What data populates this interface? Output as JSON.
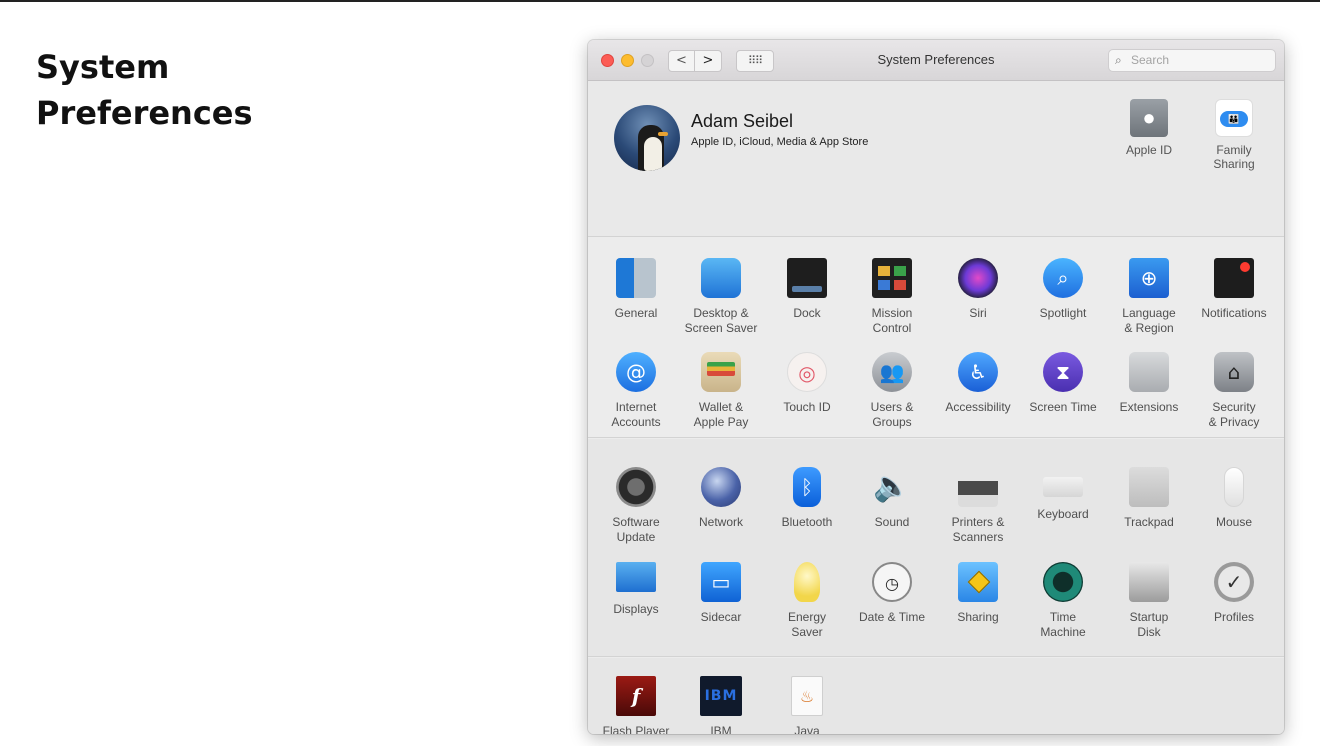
{
  "slide": {
    "title_line1": "System",
    "title_line2": "Preferences"
  },
  "window": {
    "title": "System Preferences",
    "nav": {
      "back": "<",
      "forward": ">",
      "grid": "⠿⠿"
    },
    "search": {
      "placeholder": "Search"
    }
  },
  "account": {
    "name": "Adam Seibel",
    "subtitle": "Apple ID, iCloud, Media & App Store",
    "items": [
      {
        "label": "Apple ID",
        "icon": "apple-icon"
      },
      {
        "label": "Family\nSharing",
        "icon": "family-sharing-icon"
      }
    ]
  },
  "panes_row1": [
    {
      "label": "General",
      "icon": "general-icon"
    },
    {
      "label": "Desktop &\nScreen Saver",
      "icon": "desktop-icon"
    },
    {
      "label": "Dock",
      "icon": "dock-icon"
    },
    {
      "label": "Mission\nControl",
      "icon": "mission-control-icon"
    },
    {
      "label": "Siri",
      "icon": "siri-icon"
    },
    {
      "label": "Spotlight",
      "icon": "spotlight-icon"
    },
    {
      "label": "Language\n& Region",
      "icon": "language-icon"
    },
    {
      "label": "Notifications",
      "icon": "notifications-icon"
    }
  ],
  "panes_row2": [
    {
      "label": "Internet\nAccounts",
      "icon": "internet-accounts-icon"
    },
    {
      "label": "Wallet &\nApple Pay",
      "icon": "wallet-icon"
    },
    {
      "label": "Touch ID",
      "icon": "fingerprint-icon"
    },
    {
      "label": "Users &\nGroups",
      "icon": "users-icon"
    },
    {
      "label": "Accessibility",
      "icon": "accessibility-icon"
    },
    {
      "label": "Screen Time",
      "icon": "hourglass-icon"
    },
    {
      "label": "Extensions",
      "icon": "puzzle-icon"
    },
    {
      "label": "Security\n& Privacy",
      "icon": "house-lock-icon"
    }
  ],
  "panes_row3": [
    {
      "label": "Software\nUpdate",
      "icon": "gear-icon"
    },
    {
      "label": "Network",
      "icon": "globe-icon"
    },
    {
      "label": "Bluetooth",
      "icon": "bluetooth-icon"
    },
    {
      "label": "Sound",
      "icon": "speaker-icon"
    },
    {
      "label": "Printers &\nScanners",
      "icon": "printer-icon"
    },
    {
      "label": "Keyboard",
      "icon": "keyboard-icon"
    },
    {
      "label": "Trackpad",
      "icon": "trackpad-icon"
    },
    {
      "label": "Mouse",
      "icon": "mouse-icon"
    }
  ],
  "panes_row4": [
    {
      "label": "Displays",
      "icon": "display-icon"
    },
    {
      "label": "Sidecar",
      "icon": "sidecar-icon"
    },
    {
      "label": "Energy\nSaver",
      "icon": "lightbulb-icon"
    },
    {
      "label": "Date & Time",
      "icon": "clock-icon"
    },
    {
      "label": "Sharing",
      "icon": "sharing-folder-icon"
    },
    {
      "label": "Time\nMachine",
      "icon": "time-machine-icon"
    },
    {
      "label": "Startup\nDisk",
      "icon": "disk-icon"
    },
    {
      "label": "Profiles",
      "icon": "badge-check-icon"
    }
  ],
  "panes_other": [
    {
      "label": "Flash Player",
      "icon": "flash-icon",
      "glyph": "f"
    },
    {
      "label": "IBM Registration",
      "icon": "ibm-icon",
      "glyph": "IBM"
    },
    {
      "label": "Java",
      "icon": "java-icon",
      "glyph": "♨"
    }
  ]
}
